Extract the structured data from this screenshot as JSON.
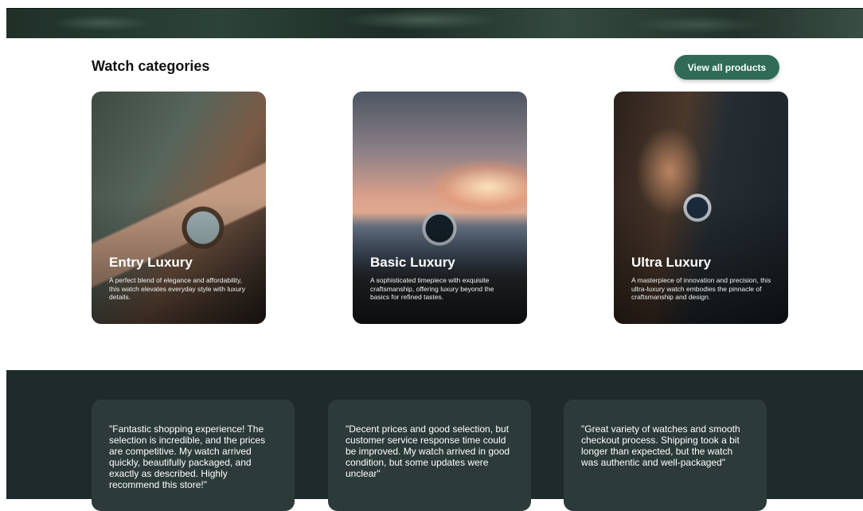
{
  "section": {
    "title": "Watch categories",
    "view_all_label": "View all products"
  },
  "categories": [
    {
      "title": "Entry Luxury",
      "description": "A perfect blend of elegance and affordability, this watch elevates everyday style with luxury details."
    },
    {
      "title": "Basic Luxury",
      "description": "A sophisticated timepiece with exquisite craftsmanship, offering luxury beyond the basics for refined tastes."
    },
    {
      "title": "Ultra Luxury",
      "description": "A masterpiece of innovation and precision, this ultra-luxury watch embodies the pinnacle of craftsmanship and design."
    }
  ],
  "testimonials": [
    "\"Fantastic shopping experience! The selection is incredible, and the prices are competitive. My watch arrived quickly, beautifully packaged, and exactly as described. Highly recommend this store!\"",
    "\"Decent prices and good selection, but customer service response time could be improved. My watch arrived in good condition, but some updates were unclear\"",
    "\"Great variety of watches and smooth checkout process. Shipping took a bit longer than expected, but the watch was authentic and well-packaged\""
  ],
  "colors": {
    "accent": "#2f6b57",
    "testimonial_bg": "#1f2b2a",
    "testimonial_card": "#2c3a3a"
  }
}
